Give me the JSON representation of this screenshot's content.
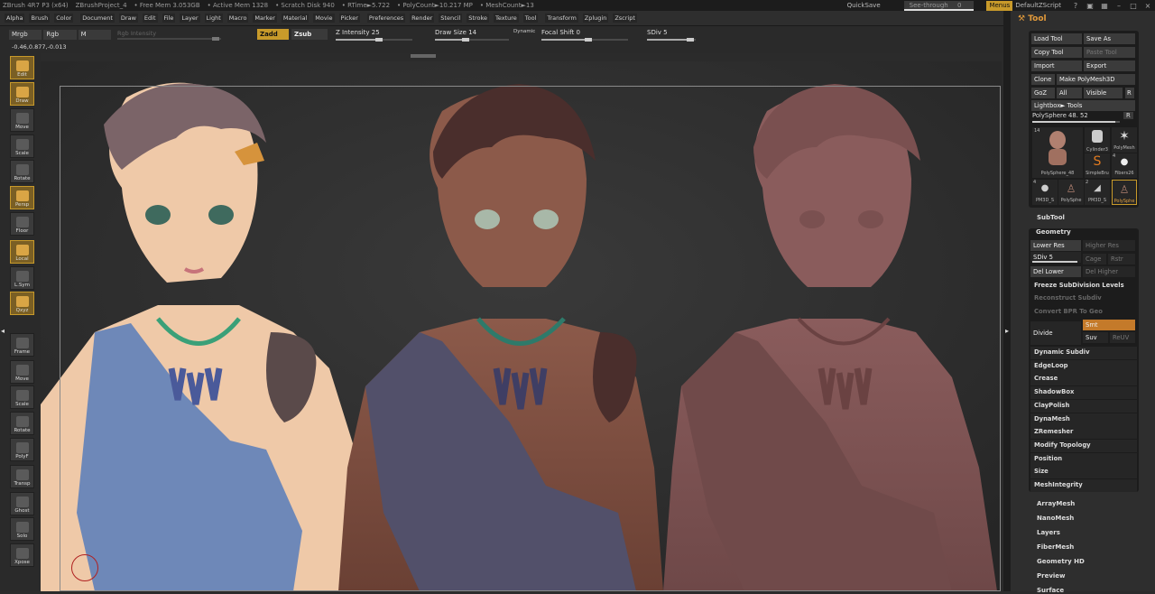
{
  "titlebar": {
    "app": "ZBrush 4R7 P3 (x64)",
    "project": "ZBrushProject_4",
    "free_mem": "• Free Mem 3.053GB",
    "active_mem": "• Active Mem 1328",
    "scratch": "• Scratch Disk 940",
    "rtime": "• RTime►5.722",
    "polycount": "• PolyCount►10.217 MP",
    "meshcount": "• MeshCount►13",
    "quicksave": "QuickSave",
    "see_through": "See-through",
    "see_through_value": "0",
    "menus": "Menus",
    "script": "DefaultZScript"
  },
  "menubar": [
    "Alpha",
    "Brush",
    "Color",
    "Document",
    "Draw",
    "Edit",
    "File",
    "Layer",
    "Light",
    "Macro",
    "Marker",
    "Material",
    "Movie",
    "Picker",
    "Preferences",
    "Render",
    "Stencil",
    "Stroke",
    "Texture",
    "Tool",
    "Transform",
    "Zplugin",
    "Zscript"
  ],
  "options": {
    "mrgb": "Mrgb",
    "rgb": "Rgb",
    "m": "M",
    "rgb_intensity": "Rgb Intensity",
    "coords": "-0.46,0.877,-0.013",
    "zadd": "Zadd",
    "zsub": "Zsub",
    "z_intensity_label": "Z Intensity",
    "z_intensity": "25",
    "draw_size_label": "Draw Size",
    "draw_size": "14",
    "dynamic": "Dynamic",
    "focal_shift_label": "Focal Shift",
    "focal_shift": "0",
    "sdiv_label": "SDiv",
    "sdiv": "5"
  },
  "lefttools": [
    {
      "label": "Edit",
      "icon": "edit-icon",
      "active": true
    },
    {
      "label": "Draw",
      "icon": "draw-icon",
      "active": true
    },
    {
      "label": "Move",
      "icon": "move-icon",
      "active": false
    },
    {
      "label": "Scale",
      "icon": "scale-icon",
      "active": false
    },
    {
      "label": "Rotate",
      "icon": "rotate-icon",
      "active": false
    },
    {
      "label": "Persp",
      "icon": "persp-icon",
      "active": true
    },
    {
      "label": "Floor",
      "icon": "floor-icon",
      "active": false
    },
    {
      "label": "Local",
      "icon": "local-icon",
      "active": true
    },
    {
      "label": "L.Sym",
      "icon": "lsym-icon",
      "active": false
    },
    {
      "label": "Qxyz",
      "icon": "xyz-icon",
      "active": true
    },
    {
      "label": "Frame",
      "icon": "frame-icon",
      "active": false
    },
    {
      "label": "Move",
      "icon": "hand-move-icon",
      "active": false
    },
    {
      "label": "Scale",
      "icon": "zoom-scale-icon",
      "active": false
    },
    {
      "label": "Rotate",
      "icon": "orbit-rotate-icon",
      "active": false
    },
    {
      "label": "PolyF",
      "icon": "polyframe-icon",
      "active": false
    },
    {
      "label": "Transp",
      "icon": "transp-icon",
      "active": false
    },
    {
      "label": "Ghost",
      "icon": "ghost-icon",
      "active": false
    },
    {
      "label": "Solo",
      "icon": "solo-icon",
      "active": false
    },
    {
      "label": "Xpose",
      "icon": "xpose-icon",
      "active": false
    }
  ],
  "tool_panel": {
    "title": "Tool",
    "load_tool": "Load Tool",
    "save_as": "Save As",
    "copy_tool": "Copy Tool",
    "paste_tool": "Paste Tool",
    "import": "Import",
    "export": "Export",
    "clone": "Clone",
    "make_polymesh": "Make PolyMesh3D",
    "goz": "GoZ",
    "all": "All",
    "visible": "Visible",
    "r": "R",
    "lightbox_tools": "Lightbox► Tools",
    "polysphere_label": "PolySphere",
    "polysphere_value": "48.",
    "polysphere_value2": "52",
    "thumbs": {
      "t1": "PolySphere_48",
      "t1_count": "14",
      "t2": "Cylinder3",
      "t3": "PolyMesh",
      "t4": "SimpleBru",
      "t4_count": "4",
      "t5": "Fibers26",
      "t6": "PM3D_S",
      "t6_count": "4",
      "t7": "PolySphe",
      "t8": "PM3D_S",
      "t8_count": "2",
      "t9": "PolySphe"
    },
    "subtool": "SubTool",
    "geometry": "Geometry",
    "lower_res": "Lower Res",
    "higher_res": "Higher Res",
    "sdiv": "SDiv 5",
    "cage": "Cage",
    "rstr": "Rstr",
    "del_lower": "Del Lower",
    "del_higher": "Del Higher",
    "freeze": "Freeze SubDivision Levels",
    "reconstruct": "Reconstruct Subdiv",
    "convert_bpr": "Convert BPR To Geo",
    "divide": "Divide",
    "smt": "Smt",
    "suv": "Suv",
    "reuv": "ReUV",
    "items": [
      "Dynamic Subdiv",
      "EdgeLoop",
      "Crease",
      "ShadowBox",
      "ClayPolish",
      "DynaMesh",
      "ZRemesher",
      "Modify Topology",
      "Position",
      "Size",
      "MeshIntegrity"
    ],
    "sections": [
      "ArrayMesh",
      "NanoMesh",
      "Layers",
      "FiberMesh",
      "Geometry HD",
      "Preview",
      "Surface"
    ]
  }
}
